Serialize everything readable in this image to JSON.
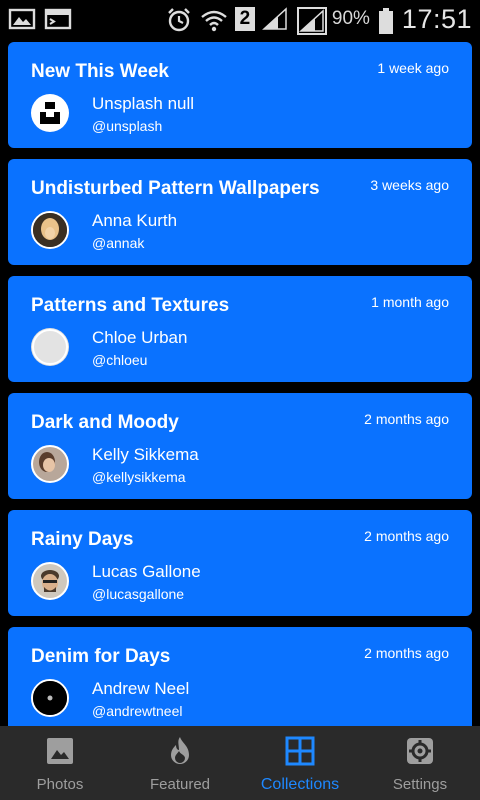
{
  "status_bar": {
    "sim_number": "2",
    "battery": "90%",
    "time": "17:51"
  },
  "collections": [
    {
      "title": "New This Week",
      "time": "1 week ago",
      "name": "Unsplash null",
      "handle": "@unsplash",
      "avatar": "unsplash-logo"
    },
    {
      "title": "Undisturbed Pattern Wallpapers",
      "time": "3 weeks ago",
      "name": "Anna Kurth",
      "handle": "@annak",
      "avatar": "photo"
    },
    {
      "title": "Patterns and Textures",
      "time": "1 month ago",
      "name": "Chloe Urban",
      "handle": "@chloeu",
      "avatar": "placeholder"
    },
    {
      "title": "Dark and Moody",
      "time": "2 months ago",
      "name": "Kelly Sikkema",
      "handle": "@kellysikkema",
      "avatar": "photo"
    },
    {
      "title": "Rainy Days",
      "time": "2 months ago",
      "name": "Lucas Gallone",
      "handle": "@lucasgallone",
      "avatar": "photo"
    },
    {
      "title": "Denim for Days",
      "time": "2 months ago",
      "name": "Andrew Neel",
      "handle": "@andrewtneel",
      "avatar": "photo"
    }
  ],
  "bottom_nav": {
    "items": [
      {
        "label": "Photos",
        "icon": "image-icon"
      },
      {
        "label": "Featured",
        "icon": "fire-icon"
      },
      {
        "label": "Collections",
        "icon": "grid-icon"
      },
      {
        "label": "Settings",
        "icon": "gear-icon"
      }
    ],
    "active_index": 2
  },
  "colors": {
    "card": "#0a72ff",
    "nav_background": "#2a2a2a",
    "nav_active": "#1e88ff",
    "nav_inactive": "#9e9e9e"
  }
}
